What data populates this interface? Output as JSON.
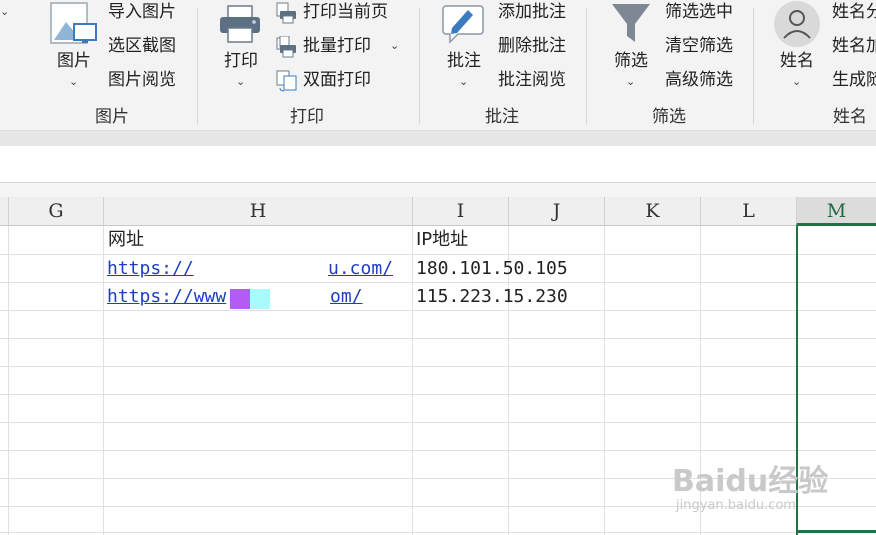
{
  "ribbon": {
    "top_caret": "⌄",
    "groups": {
      "picture": {
        "label": "图片",
        "button": "图片",
        "caret": "⌄",
        "items": [
          "导入图片",
          "选区截图",
          "图片阅览"
        ]
      },
      "print": {
        "label": "打印",
        "button": "打印",
        "caret": "⌄",
        "items": [
          "打印当前页",
          "批量打印",
          "双面打印"
        ],
        "item_caret": "⌄"
      },
      "comment": {
        "label": "批注",
        "button": "批注",
        "caret": "⌄",
        "items": [
          "添加批注",
          "删除批注",
          "批注阅览"
        ]
      },
      "filter": {
        "label": "筛选",
        "button": "筛选",
        "caret": "⌄",
        "items": [
          "筛选选中",
          "清空筛选",
          "高级筛选"
        ]
      },
      "name": {
        "label": "姓名",
        "button": "姓名",
        "caret": "⌄",
        "items": [
          "姓名分",
          "姓名加",
          "生成随"
        ]
      }
    }
  },
  "sheet": {
    "columns": [
      "G",
      "H",
      "I",
      "J",
      "K",
      "L",
      "M"
    ],
    "selected_column": "M",
    "headers": {
      "url": "网址",
      "ip": "IP地址"
    },
    "rows": [
      {
        "url_start": "https://",
        "url_end": "u.com/",
        "ip": "180.101.50.105"
      },
      {
        "url_start": "https://www",
        "url_end": "om/",
        "ip": "115.223.15.230"
      }
    ]
  },
  "watermark": {
    "brand": "Baidu经验",
    "site": "jingyan.baidu.com"
  },
  "colors": {
    "accent_green": "#217346",
    "link_blue": "#1d3fbf",
    "redact_purple": "#b45cf2",
    "redact_cyan": "#a9fbfb"
  }
}
